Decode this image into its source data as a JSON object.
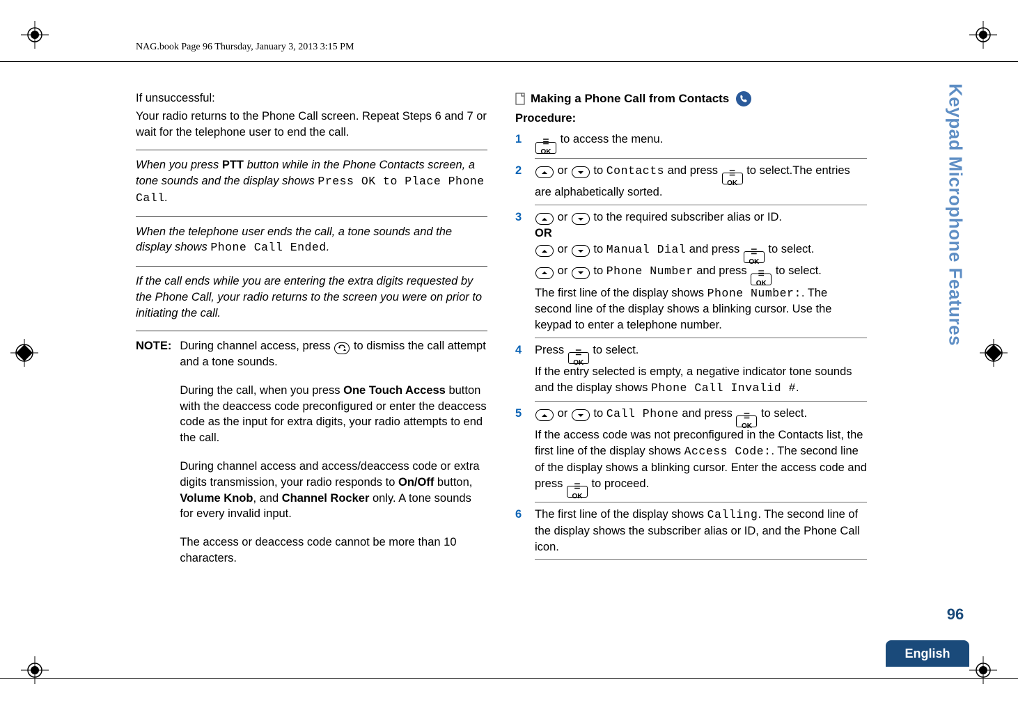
{
  "header": {
    "running_head": "NAG.book  Page 96  Thursday, January 3, 2013  3:15 PM"
  },
  "left": {
    "if_unsuccessful_label": "If unsuccessful:",
    "if_unsuccessful_body": "Your radio returns to the Phone Call screen. Repeat Steps 6 and 7 or wait for the telephone user to end the call.",
    "para1_a": "When you press ",
    "para1_ptt": "PTT",
    "para1_b": " button while in the Phone Contacts screen, a tone sounds and the display shows ",
    "para1_lcd": "Press OK to Place Phone Call",
    "para1_c": ".",
    "para2_a": "When the telephone user ends the call, a tone sounds and the display shows ",
    "para2_lcd": "Phone Call Ended",
    "para2_b": ".",
    "para3": "If the call ends while you are entering the extra digits requested by the Phone Call, your radio returns to the screen you were on prior to initiating the call.",
    "note_label": "NOTE:",
    "note1_a": "During channel access, press ",
    "note1_b": " to dismiss the call attempt and a tone sounds.",
    "note2_a": "During the call, when you press ",
    "note2_ota": "One Touch Access",
    "note2_b": " button with the deaccess code preconfigured or enter the deaccess code as the input for extra digits, your radio attempts to end the call.",
    "note3_a": "During channel access and access/deaccess code or extra digits transmission, your radio responds to ",
    "note3_onoff": "On/Off",
    "note3_b": " button, ",
    "note3_vol": "Volume Knob",
    "note3_c": ", and ",
    "note3_chan": "Channel Rocker",
    "note3_d": " only. A tone sounds for every invalid input.",
    "note4": "The access or deaccess code cannot be more than 10 characters."
  },
  "right": {
    "title": "Making a Phone Call from Contacts",
    "procedure_label": "Procedure:",
    "steps": {
      "s1": {
        "num": "1",
        "a": " to access the menu."
      },
      "s2": {
        "num": "2",
        "a": " or ",
        "b": " to ",
        "lcd1": "Contacts",
        "c": " and press ",
        "d": " to select.The entries are alphabetically sorted."
      },
      "s3": {
        "num": "3",
        "a": " or ",
        "b": " to the required subscriber alias or ID.",
        "or": "OR",
        "c": " or ",
        "d": " to ",
        "lcd1": "Manual Dial",
        "e": " and press ",
        "f": " to select.",
        "g": " or ",
        "h": " to ",
        "lcd2": "Phone Number",
        "i": " and press ",
        "j": " to select.",
        "k": "The first line of the display shows ",
        "lcd3": "Phone Number:",
        "l": ". The second line of the display shows a blinking cursor. Use the keypad to enter a telephone number."
      },
      "s4": {
        "num": "4",
        "a": "Press ",
        "b": " to select.",
        "c": "If the entry selected is empty, a negative indicator tone sounds and the display shows ",
        "lcd1": "Phone Call Invalid #",
        "d": "."
      },
      "s5": {
        "num": "5",
        "a": " or ",
        "b": " to ",
        "lcd1": "Call Phone",
        "c": " and press ",
        "d": " to select.",
        "e": "If the access code was not preconfigured in the Contacts list, the first line of the display shows ",
        "lcd2": "Access Code:",
        "f": ". The second line of the display shows a blinking cursor. Enter the access code and press ",
        "g": " to proceed."
      },
      "s6": {
        "num": "6",
        "a": "The first line of the display shows ",
        "lcd1": "Calling",
        "b": ". The second line of the display shows the subscriber alias or ID, and the Phone Call icon."
      }
    }
  },
  "icons": {
    "ok_label": "☰ OK",
    "doc": "doc-icon",
    "phone": "phone-icon",
    "up": "up-arrow-icon",
    "down": "down-arrow-icon",
    "back": "back-icon"
  },
  "sidebar": {
    "tab_text": "Keypad Microphone Features",
    "page_number": "96",
    "language": "English"
  }
}
